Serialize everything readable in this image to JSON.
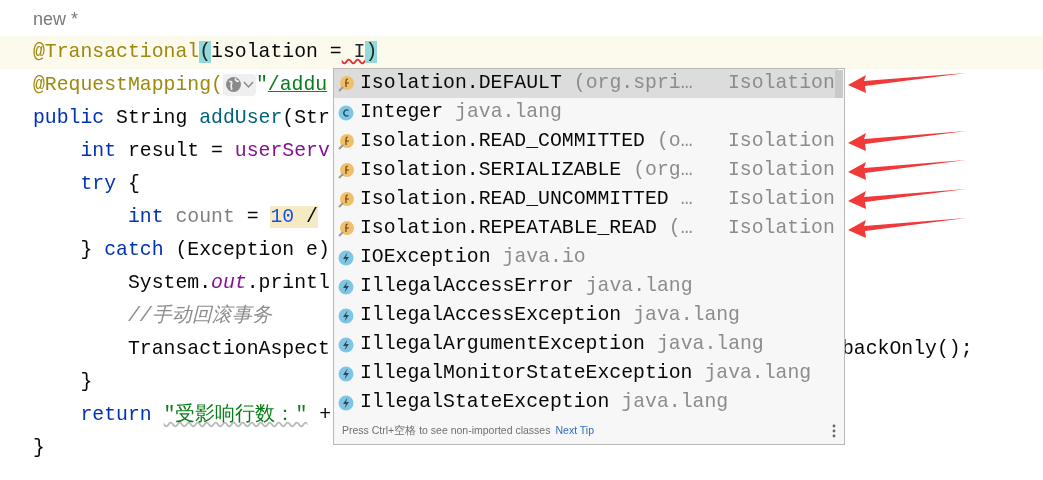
{
  "editor": {
    "lines": [
      {
        "current": false,
        "tokens": [
          {
            "text": "new *",
            "kind": "hint"
          }
        ]
      },
      {
        "current": true,
        "tokens": [
          {
            "text": "@Transactional",
            "kind": "annotation"
          },
          {
            "text": "(",
            "kind": "brace-match"
          },
          {
            "text": "isolation =",
            "kind": "plain"
          },
          {
            "text": " I",
            "kind": "error"
          },
          {
            "text": ")",
            "kind": "brace-match"
          }
        ]
      },
      {
        "current": false,
        "tokens": [
          {
            "text": "@RequestMapping(",
            "kind": "annotation"
          },
          {
            "kind": "globe-inlay"
          },
          {
            "text": "\"",
            "kind": "string"
          },
          {
            "text": "/addu",
            "kind": "url"
          }
        ]
      },
      {
        "current": false,
        "tokens": [
          {
            "text": "public",
            "kind": "keyword"
          },
          {
            "text": " String ",
            "kind": "plain"
          },
          {
            "text": "addUser",
            "kind": "method"
          },
          {
            "text": "(Str",
            "kind": "plain"
          }
        ],
        "children": [
          {
            "current": false,
            "tokens": [
              {
                "text": "int",
                "kind": "keyword"
              },
              {
                "text": " result = ",
                "kind": "plain"
              },
              {
                "text": "userServ",
                "kind": "field"
              }
            ]
          },
          {
            "current": false,
            "tokens": [
              {
                "text": "try",
                "kind": "keyword"
              },
              {
                "text": " {",
                "kind": "plain"
              }
            ],
            "children": [
              {
                "current": false,
                "tokens": [
                  {
                    "text": "int",
                    "kind": "keyword"
                  },
                  {
                    "text": " count",
                    "kind": "unused"
                  },
                  {
                    "text": " = ",
                    "kind": "plain"
                  },
                  {
                    "text": "10",
                    "kind": "number-marked"
                  },
                  {
                    "text": " /",
                    "kind": "plain-marked"
                  }
                ]
              }
            ]
          },
          {
            "current": false,
            "tokens": [
              {
                "text": "} ",
                "kind": "plain"
              },
              {
                "text": "catch",
                "kind": "keyword"
              },
              {
                "text": " (Exception e)",
                "kind": "plain"
              }
            ],
            "children": [
              {
                "current": false,
                "tokens": [
                  {
                    "text": "System.",
                    "kind": "plain"
                  },
                  {
                    "text": "out",
                    "kind": "static-field"
                  },
                  {
                    "text": ".printl",
                    "kind": "plain"
                  }
                ]
              },
              {
                "current": false,
                "tokens": [
                  {
                    "text": "//手动回滚事务",
                    "kind": "comment"
                  }
                ]
              },
              {
                "current": false,
                "tokens": [
                  {
                    "text": "TransactionAspect",
                    "kind": "plain"
                  }
                ],
                "after_popup": "backOnly();"
              }
            ]
          },
          {
            "current": false,
            "tokens": [
              {
                "text": "}",
                "kind": "plain"
              }
            ]
          },
          {
            "current": false,
            "tokens": [
              {
                "text": "return ",
                "kind": "keyword"
              },
              {
                "text": "\"受影响行数：\"",
                "kind": "string-typo"
              },
              {
                "text": " +",
                "kind": "plain"
              }
            ]
          }
        ]
      },
      {
        "current": false,
        "tokens": [
          {
            "text": "}",
            "kind": "plain"
          }
        ]
      }
    ]
  },
  "completion": {
    "items": [
      {
        "kind": "field",
        "name": "Isolation.DEFAULT",
        "detail": "(org.spri…",
        "type": "Isolation",
        "selected": true,
        "arrow": true
      },
      {
        "kind": "class",
        "name": "Integer",
        "detail": "java.lang",
        "selected": false,
        "arrow": false
      },
      {
        "kind": "field",
        "name": "Isolation.READ_COMMITTED",
        "detail": "(o…",
        "type": "Isolation",
        "selected": false,
        "arrow": true
      },
      {
        "kind": "field",
        "name": "Isolation.SERIALIZABLE",
        "detail": "(org…",
        "type": "Isolation",
        "selected": false,
        "arrow": true
      },
      {
        "kind": "field",
        "name": "Isolation.READ_UNCOMMITTED",
        "detail": "…",
        "type": "Isolation",
        "selected": false,
        "arrow": true
      },
      {
        "kind": "field",
        "name": "Isolation.REPEATABLE_READ",
        "detail": "(…",
        "type": "Isolation",
        "selected": false,
        "arrow": true
      },
      {
        "kind": "exception",
        "name": "IOException",
        "detail": "java.io",
        "selected": false,
        "arrow": false
      },
      {
        "kind": "exception",
        "name": "IllegalAccessError",
        "detail": "java.lang",
        "selected": false,
        "arrow": false
      },
      {
        "kind": "exception",
        "name": "IllegalAccessException",
        "detail": "java.lang",
        "selected": false,
        "arrow": false
      },
      {
        "kind": "exception",
        "name": "IllegalArgumentException",
        "detail": "java.lang",
        "selected": false,
        "arrow": false
      },
      {
        "kind": "exception",
        "name": "IllegalMonitorStateException",
        "detail": "java.lang",
        "selected": false,
        "arrow": false
      },
      {
        "kind": "exception",
        "name": "IllegalStateException",
        "detail": "java.lang",
        "selected": false,
        "arrow": false
      }
    ],
    "footer": {
      "hint": "Press Ctrl+空格 to see non-imported classes",
      "link": "Next Tip"
    }
  }
}
